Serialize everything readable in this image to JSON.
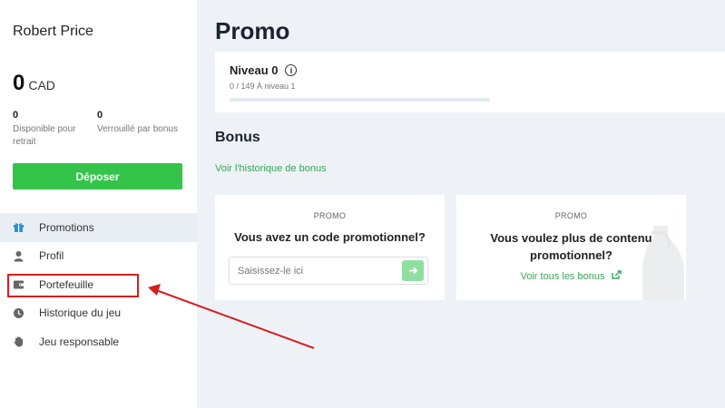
{
  "sidebar": {
    "username": "Robert Price",
    "balance": {
      "amount": "0",
      "currency": "CAD"
    },
    "available": {
      "value": "0",
      "label": "Disponible pour retrait"
    },
    "locked": {
      "value": "0",
      "label": "Verrouillé par bonus"
    },
    "deposit_label": "Déposer",
    "menu": [
      {
        "label": "Promotions",
        "icon": "gift-icon",
        "active": true
      },
      {
        "label": "Profil",
        "icon": "user-icon",
        "active": false
      },
      {
        "label": "Portefeuille",
        "icon": "wallet-icon",
        "active": false
      },
      {
        "label": "Historique du jeu",
        "icon": "clock-icon",
        "active": false
      },
      {
        "label": "Jeu responsable",
        "icon": "hand-icon",
        "active": false
      }
    ]
  },
  "main": {
    "title": "Promo",
    "level": {
      "name": "Niveau 0",
      "progress_text": "0 / 149 À niveau 1",
      "progress": 0
    },
    "bonus_title": "Bonus",
    "history_link": "Voir l'historique de bonus",
    "promo_card": {
      "label": "PROMO",
      "question": "Vous avez un code promotionnel?",
      "placeholder": "Saisissez-le ici"
    },
    "content_card": {
      "label": "PROMO",
      "question": "Vous voulez plus de contenu promotionnel?",
      "link": "Voir tous les bonus"
    }
  },
  "colors": {
    "accent": "#34c44a",
    "link": "#34a853",
    "annotation": "#d51f1f"
  }
}
